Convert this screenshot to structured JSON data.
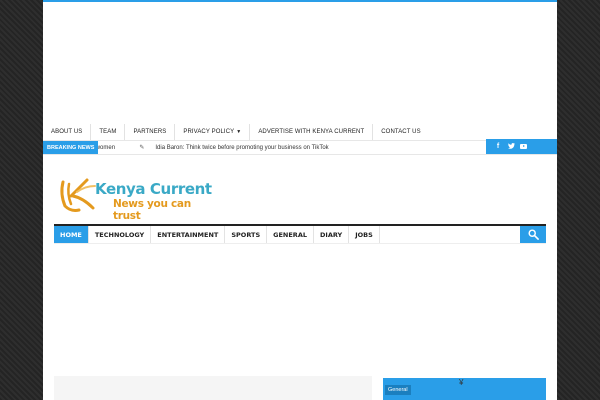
{
  "top_nav": {
    "items": [
      {
        "label": "ABOUT US"
      },
      {
        "label": "TEAM"
      },
      {
        "label": "PARTNERS"
      },
      {
        "label": "PRIVACY POLICY",
        "has_dropdown": true
      },
      {
        "label": "ADVERTISE WITH KENYA CURRENT"
      },
      {
        "label": "CONTACT US"
      }
    ]
  },
  "breaking": {
    "label": "BREAKING NEWS",
    "previous_tail": "t women",
    "current": "Idia Baron: Think twice before promoting your business on TikTok"
  },
  "social": {
    "icons": [
      "facebook-icon",
      "twitter-icon",
      "youtube-icon"
    ],
    "facebook_glyph": "f",
    "twitter_glyph": "🐦"
  },
  "logo": {
    "title": "Kenya Current",
    "tagline": "News you can trust"
  },
  "main_nav": {
    "items": [
      {
        "label": "HOME",
        "active": true
      },
      {
        "label": "TECHNOLOGY"
      },
      {
        "label": "ENTERTAINMENT"
      },
      {
        "label": "SPORTS"
      },
      {
        "label": "GENERAL"
      },
      {
        "label": "DIARY"
      },
      {
        "label": "JOBS"
      }
    ]
  },
  "sidebar": {
    "category_tag": "General"
  },
  "colors": {
    "accent": "#2a9ee8",
    "logo_teal": "#3aa9c6",
    "logo_orange": "#e49a1e"
  }
}
